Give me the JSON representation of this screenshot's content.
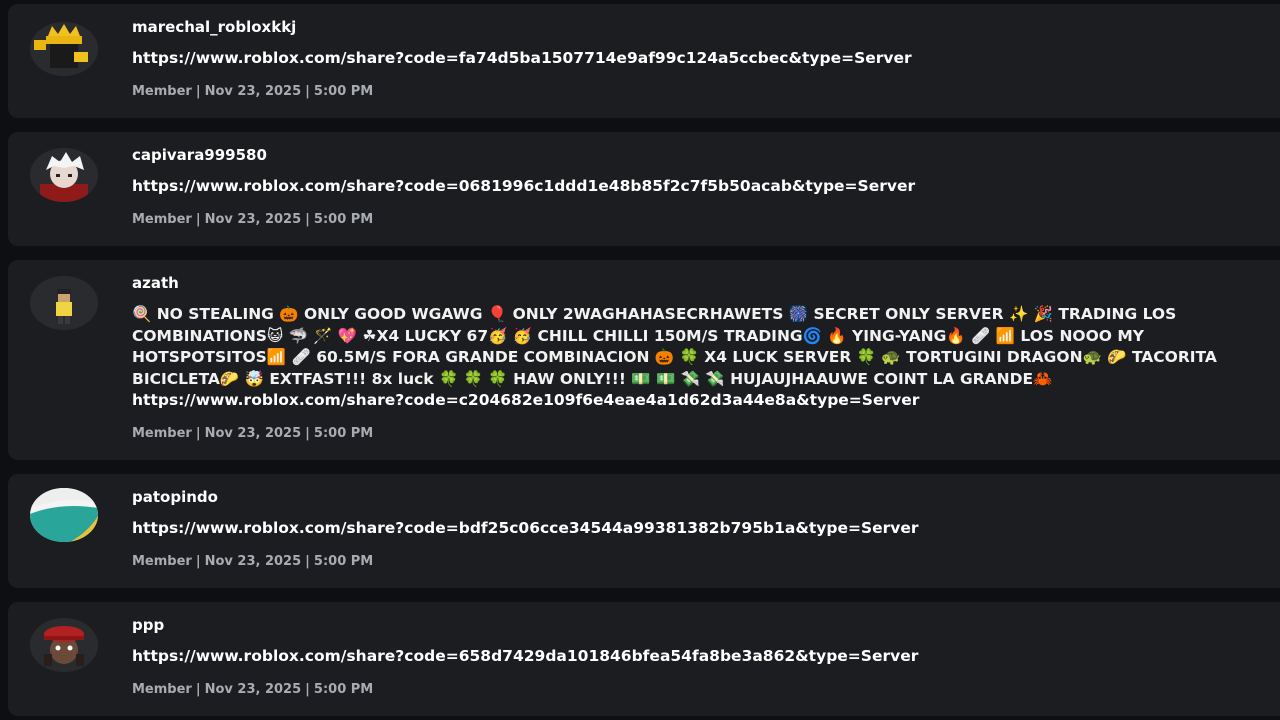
{
  "posts": [
    {
      "avatar_icon": "roblox-avatar-crown-icon",
      "username": "marechal_robloxkkj",
      "lines": [
        "https://www.roblox.com/share?code=fa74d5ba1507714e9af99c124a5ccbec&type=Server"
      ],
      "role": "Member",
      "date": "Nov 23, 2025",
      "time": "5:00 PM"
    },
    {
      "avatar_icon": "roblox-avatar-white-hair-icon",
      "username": "capivara999580",
      "lines": [
        "https://www.roblox.com/share?code=0681996c1ddd1e48b85f2c7f5b50acab&type=Server"
      ],
      "role": "Member",
      "date": "Nov 23, 2025",
      "time": "5:00 PM"
    },
    {
      "avatar_icon": "roblox-avatar-small-figure-icon",
      "username": "azath",
      "lines": [
        "🍭 NO STEALING 🎃 ONLY GOOD WGAWG 🎈 ONLY 2WAGHAHASECRHAWETS 🎆 SECRET ONLY SERVER ✨ 🎉 TRADING LOS",
        "COMBINATIONS😺 🦈 🪄 💖 ☘X4 LUCKY 67🥳 🥳 CHILL CHILLI 150M/S TRADING🌀 🔥 YING-YANG🔥 🩹 📶 LOS NOOO MY",
        "HOTSPOTSITOS📶 🩹 60.5M/S FORA GRANDE COMBINACION 🎃 🍀 X4 LUCK SERVER 🍀 🐢 TORTUGINI DRAGON🐢 🌮 TACORITA",
        "BICICLETA🌮 🤯 EXTFAST!!! 8x luck 🍀 🍀 🍀 HAW ONLY!!! 💵 💵 💸 💸 HUJAUJHAAUWE COINT LA GRANDE🦀",
        "https://www.roblox.com/share?code=c204682e109f6e4eae4a1d62d3a44e8a&type=Server"
      ],
      "role": "Member",
      "date": "Nov 23, 2025",
      "time": "5:00 PM"
    },
    {
      "avatar_icon": "teal-yellow-avatar-icon",
      "username": "patopindo",
      "lines": [
        "https://www.roblox.com/share?code=bdf25c06cce34544a99381382b795b1a&type=Server"
      ],
      "role": "Member",
      "date": "Nov 23, 2025",
      "time": "5:00 PM"
    },
    {
      "avatar_icon": "roblox-avatar-red-cap-icon",
      "username": "ppp",
      "lines": [
        "https://www.roblox.com/share?code=658d7429da101846bfea54fa8be3a862&type=Server"
      ],
      "role": "Member",
      "date": "Nov 23, 2025",
      "time": "5:00 PM"
    }
  ],
  "colors": {
    "background": "#0e0f12",
    "card": "#1c1d21",
    "text": "#ffffff",
    "meta": "#a9abb3"
  }
}
